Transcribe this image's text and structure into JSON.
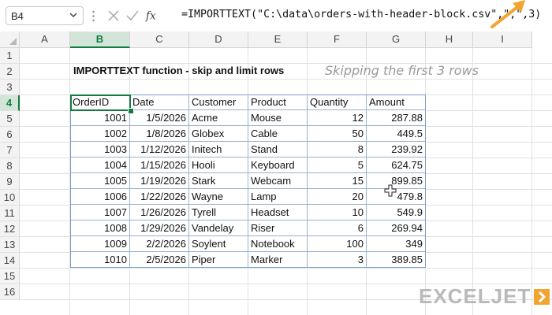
{
  "namebox": {
    "value": "B4"
  },
  "formula_bar": {
    "formula": "=IMPORTTEXT(\"C:\\data\\orders-with-header-block.csv\",\",\",3)"
  },
  "columns": [
    "A",
    "B",
    "C",
    "D",
    "E",
    "F",
    "G",
    "H",
    "I"
  ],
  "rows": [
    "1",
    "2",
    "3",
    "4",
    "5",
    "6",
    "7",
    "8",
    "9",
    "10",
    "11",
    "12",
    "13",
    "14",
    "15",
    "16"
  ],
  "selected": {
    "column": "B",
    "row": "4"
  },
  "sheet": {
    "title": "IMPORTTEXT function - skip and limit rows",
    "note": "Skipping the first 3 rows"
  },
  "table": {
    "headers": [
      "OrderID",
      "Date",
      "Customer",
      "Product",
      "Quantity",
      "Amount"
    ],
    "rows": [
      [
        "1001",
        "1/5/2026",
        "Acme",
        "Mouse",
        "12",
        "287.88"
      ],
      [
        "1002",
        "1/8/2026",
        "Globex",
        "Cable",
        "50",
        "449.5"
      ],
      [
        "1003",
        "1/12/2026",
        "Initech",
        "Stand",
        "8",
        "239.92"
      ],
      [
        "1004",
        "1/15/2026",
        "Hooli",
        "Keyboard",
        "5",
        "624.75"
      ],
      [
        "1005",
        "1/19/2026",
        "Stark",
        "Webcam",
        "15",
        "899.85"
      ],
      [
        "1006",
        "1/22/2026",
        "Wayne",
        "Lamp",
        "20",
        "479.8"
      ],
      [
        "1007",
        "1/26/2026",
        "Tyrell",
        "Headset",
        "10",
        "549.9"
      ],
      [
        "1008",
        "1/29/2026",
        "Vandelay",
        "Riser",
        "6",
        "269.94"
      ],
      [
        "1009",
        "2/2/2026",
        "Soylent",
        "Notebook",
        "100",
        "349"
      ],
      [
        "1010",
        "2/5/2026",
        "Piper",
        "Marker",
        "3",
        "389.85"
      ]
    ],
    "numeric_columns": [
      0,
      1,
      4,
      5
    ]
  },
  "logo": {
    "text": "EXCELJET"
  },
  "colors": {
    "accent": "#107c41",
    "arrow": "#f2a431",
    "table_border": "#7f9cc8"
  }
}
